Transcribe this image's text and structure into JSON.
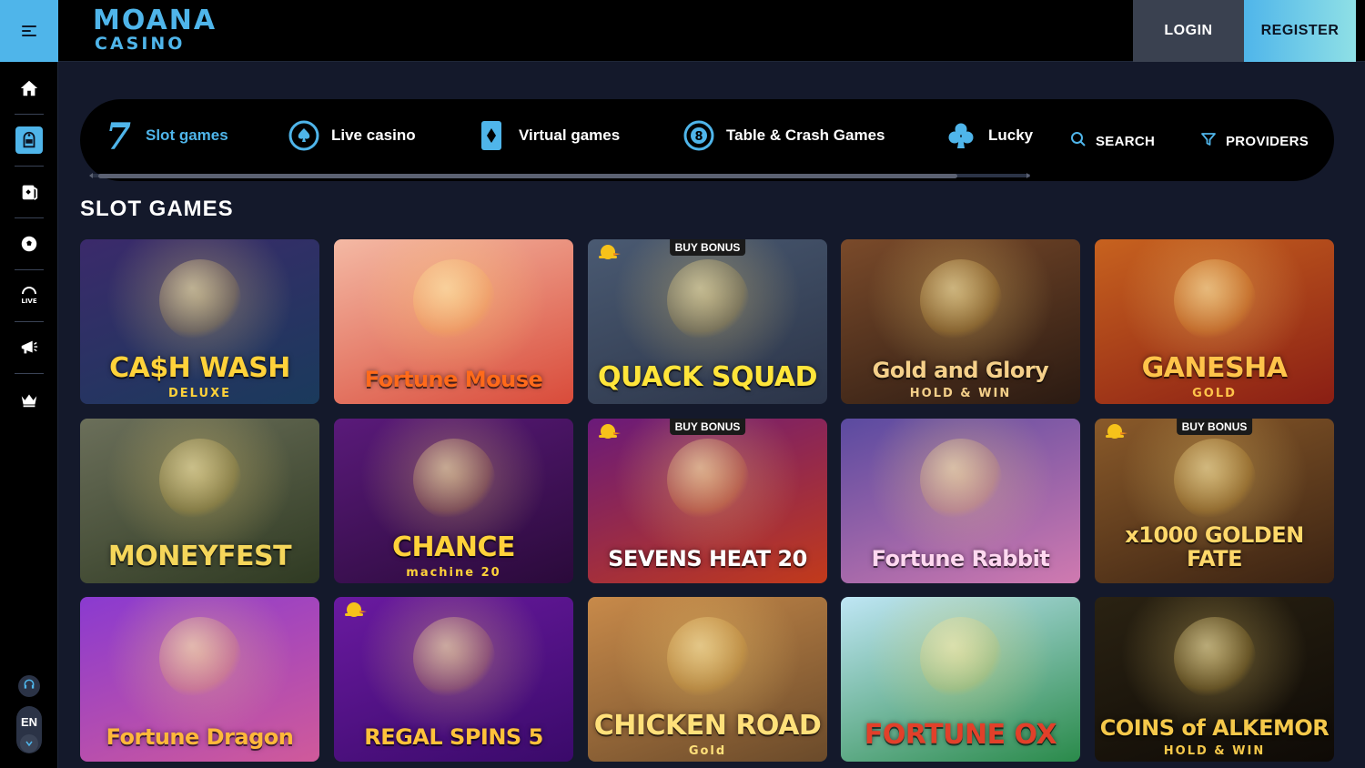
{
  "header": {
    "logo_line1": "MOANA",
    "logo_line2": "CASINO",
    "login_label": "LOGIN",
    "register_label": "REGISTER"
  },
  "sidebar": {
    "items": [
      {
        "icon": "home-icon"
      },
      {
        "icon": "slots-icon",
        "active": true
      },
      {
        "icon": "cards-icon"
      },
      {
        "icon": "sports-icon"
      },
      {
        "icon": "live-icon",
        "label": "LIVE"
      },
      {
        "icon": "promotions-icon"
      },
      {
        "icon": "vip-crown-icon"
      }
    ],
    "language": "EN"
  },
  "categories": [
    {
      "label": "Slot games",
      "icon": "seven-icon",
      "active": true
    },
    {
      "label": "Live casino",
      "icon": "spade-circle-icon"
    },
    {
      "label": "Virtual games",
      "icon": "diamond-card-icon"
    },
    {
      "label": "Table & Crash Games",
      "icon": "eight-ball-icon"
    },
    {
      "label": "Lucky",
      "icon": "club-icon"
    }
  ],
  "tools": {
    "search_label": "SEARCH",
    "providers_label": "PROVIDERS"
  },
  "section_title": "SLOT GAMES",
  "games": [
    {
      "title": "CA$H WASH",
      "subtitle": "DELUXE",
      "colors": [
        "#3b2a6b",
        "#1a3a5c"
      ],
      "title_color": "#ffd23a"
    },
    {
      "title": "Fortune Mouse",
      "subtitle": "",
      "colors": [
        "#f4b9a4",
        "#d94b3a"
      ],
      "title_color": "#ff6a1a"
    },
    {
      "title": "QUACK SQUAD",
      "subtitle": "",
      "badge": "BUY BONUS",
      "duck": true,
      "colors": [
        "#4a5a72",
        "#2b3448"
      ],
      "title_color": "#ffe53a"
    },
    {
      "title": "Gold and Glory",
      "subtitle": "HOLD & WIN",
      "colors": [
        "#7a4a2a",
        "#2a1a12"
      ],
      "title_color": "#f5d08a"
    },
    {
      "title": "GANESHA",
      "subtitle": "GOLD",
      "colors": [
        "#c7621f",
        "#8a1e14"
      ],
      "title_color": "#ffc44a"
    },
    {
      "title": "MONEYFEST",
      "subtitle": "",
      "colors": [
        "#6b6f5a",
        "#2f3a22"
      ],
      "title_color": "#f5d65a"
    },
    {
      "title": "CHANCE",
      "subtitle": "machine 20",
      "colors": [
        "#5a1a7a",
        "#2a0a3a"
      ],
      "title_color": "#ffd23a"
    },
    {
      "title": "SEVENS HEAT 20",
      "subtitle": "",
      "badge": "BUY BONUS",
      "duck": true,
      "colors": [
        "#6a1a7a",
        "#c23a1a"
      ],
      "title_color": "#ffffff"
    },
    {
      "title": "Fortune Rabbit",
      "subtitle": "",
      "colors": [
        "#5a4aa0",
        "#d07ab0"
      ],
      "title_color": "#ffd8f0"
    },
    {
      "title": "x1000 GOLDEN FATE",
      "subtitle": "",
      "badge": "BUY BONUS",
      "duck": true,
      "colors": [
        "#8a5a2a",
        "#3a2212"
      ],
      "title_color": "#ffd86a"
    },
    {
      "title": "Fortune Dragon",
      "subtitle": "",
      "colors": [
        "#8a3ad0",
        "#d05a9a"
      ],
      "title_color": "#ffb83a"
    },
    {
      "title": "REGAL SPINS 5",
      "subtitle": "",
      "duck": true,
      "colors": [
        "#6a1aa0",
        "#3a0a6a"
      ],
      "title_color": "#ffc23a"
    },
    {
      "title": "CHICKEN ROAD",
      "subtitle": "Gold",
      "colors": [
        "#c88a4a",
        "#6a4a2a"
      ],
      "title_color": "#ffe07a"
    },
    {
      "title": "FORTUNE OX",
      "subtitle": "",
      "colors": [
        "#bfe6f5",
        "#2a8a4a"
      ],
      "title_color": "#e2402a"
    },
    {
      "title": "COINS of ALKEMOR",
      "subtitle": "HOLD & WIN",
      "colors": [
        "#2a2212",
        "#0e0a06"
      ],
      "title_color": "#f5c84a"
    }
  ],
  "colors": {
    "accent": "#4fb5ea",
    "background": "#14192b",
    "panel": "#000000"
  }
}
